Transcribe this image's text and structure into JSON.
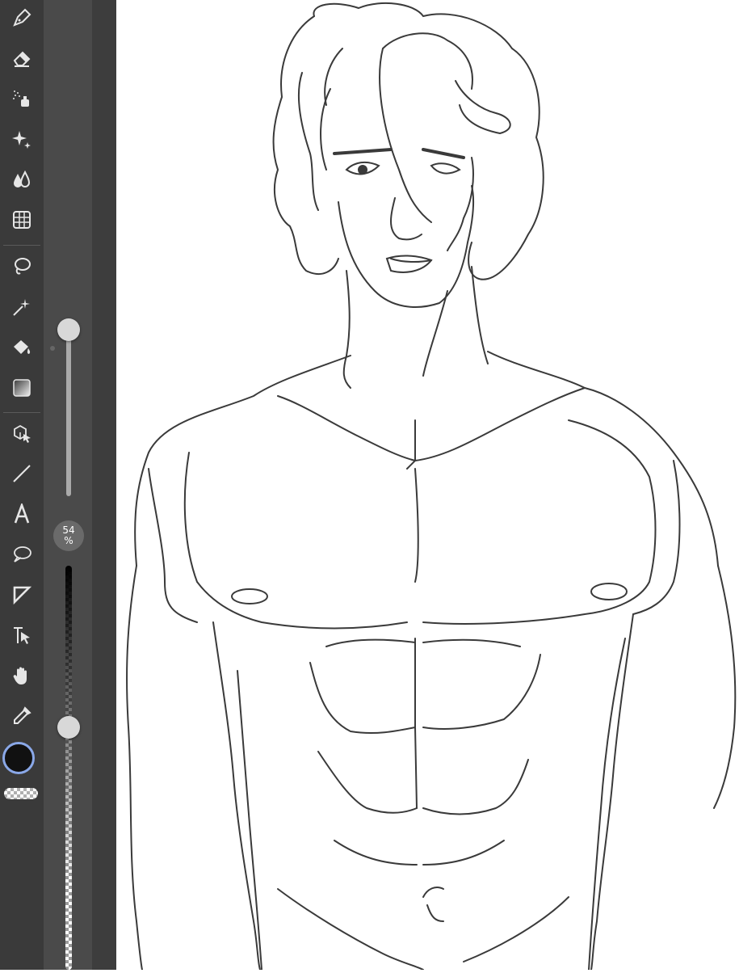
{
  "toolbar": {
    "tools": [
      {
        "name": "brush-tool",
        "icon": "pen-nib-icon"
      },
      {
        "name": "eraser-tool",
        "icon": "eraser-icon"
      },
      {
        "name": "airbrush-tool",
        "icon": "airbrush-icon"
      },
      {
        "name": "effects-tool",
        "icon": "sparkle-icon"
      },
      {
        "name": "blend-tool",
        "icon": "drops-icon"
      },
      {
        "name": "grid-tool",
        "icon": "grid-icon"
      },
      {
        "name": "lasso-tool",
        "icon": "lasso-icon"
      },
      {
        "name": "magic-wand-tool",
        "icon": "magic-wand-icon"
      },
      {
        "name": "fill-tool",
        "icon": "paint-bucket-icon"
      },
      {
        "name": "gradient-tool",
        "icon": "gradient-icon"
      },
      {
        "name": "3d-transform-tool",
        "icon": "cube-cursor-icon"
      },
      {
        "name": "line-tool",
        "icon": "line-icon"
      },
      {
        "name": "text-tool",
        "icon": "text-a-icon"
      },
      {
        "name": "speech-bubble-tool",
        "icon": "speech-bubble-icon"
      },
      {
        "name": "frame-tool",
        "icon": "triangle-frame-icon"
      },
      {
        "name": "select-layer-tool",
        "icon": "move-arrow-icon"
      },
      {
        "name": "hand-tool",
        "icon": "hand-icon"
      },
      {
        "name": "eyedropper-tool",
        "icon": "eyedropper-icon"
      }
    ]
  },
  "brush": {
    "size_value": "54",
    "size_unit": "%",
    "size_level": 0.54,
    "opacity_level": 0.6
  },
  "colors": {
    "primary": "#111111",
    "primary_ring": "#8aa8e8",
    "panel_bg": "#3a3a3a"
  }
}
